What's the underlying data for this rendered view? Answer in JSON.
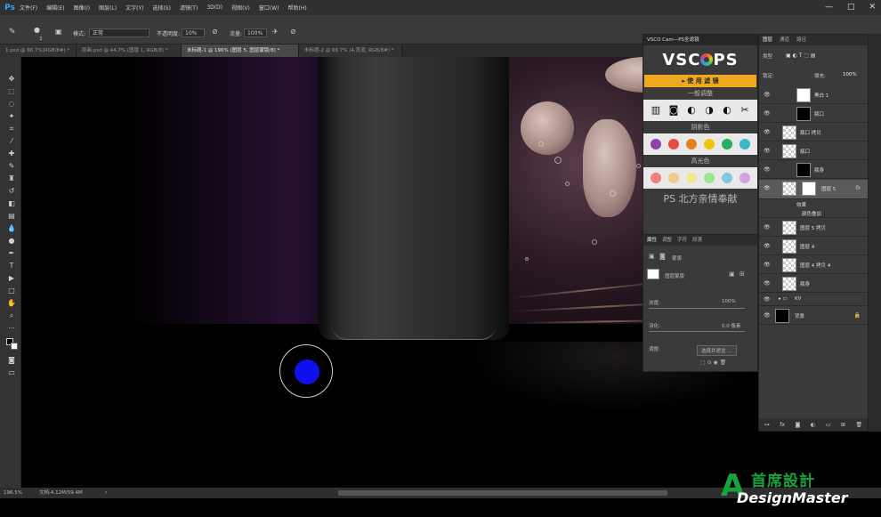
{
  "app": {
    "logo": "Ps"
  },
  "menu": [
    "文件(F)",
    "编辑(E)",
    "图像(I)",
    "图层(L)",
    "文字(Y)",
    "选择(S)",
    "滤镜(T)",
    "3D(D)",
    "视图(V)",
    "窗口(W)",
    "帮助(H)"
  ],
  "window_controls": [
    "—",
    "□",
    "✕"
  ],
  "options": {
    "brush_size": "3",
    "mode_label": "模式:",
    "mode_value": "正常",
    "opacity_label": "不透明度:",
    "opacity_value": "10%",
    "flow_label": "流量:",
    "flow_value": "100%"
  },
  "tabs": [
    {
      "label": "1.psd @ 66.7%(RGB/8#) *",
      "active": false
    },
    {
      "label": "原画.psd @ 44.7% (图层 1, RGB/8) *",
      "active": false
    },
    {
      "label": "未标题-1 @ 196% (图层 5, 图层蒙版/8) *",
      "active": true
    },
    {
      "label": "未标题-2 @ 66.7% (4,背道, RGB/8#) *",
      "active": false
    }
  ],
  "vsco": {
    "title": "VSCO Cam—PS全滤镜",
    "logo_left": "VSC",
    "logo_right": "PS",
    "use_button": "▸  使 用 滤 镜",
    "section_general": "一般调整",
    "section_shadow": "阴影色",
    "section_highlight": "高光色",
    "watermark": "PS 北方亲情奉献",
    "shadow_colors": [
      "#8e44ad",
      "#e74c3c",
      "#e67e22",
      "#f1c40f",
      "#27ae60",
      "#3cb8c4"
    ],
    "highlight_colors": [
      "#f08080",
      "#f0c890",
      "#f0e68c",
      "#9be38c",
      "#7ec8e3",
      "#d6a0e8"
    ]
  },
  "properties": {
    "tabs": [
      "属性",
      "调整",
      "字符",
      "段落"
    ],
    "mask_label": "蒙版",
    "layer_mask_label": "图层蒙版",
    "density_label": "浓度:",
    "density_value": "100%",
    "feather_label": "羽化:",
    "feather_value": "0.0 像素",
    "refine_label": "调整:",
    "refine_button": "选择并遮住 ..."
  },
  "layers": {
    "tabs": [
      "图层",
      "通道",
      "路径"
    ],
    "kind": "类型",
    "fill_label": "填充:",
    "fill_value": "100%",
    "lock_label": "锁定:",
    "rows": [
      {
        "name": "黑白 1",
        "thumb": "white",
        "indent": 0
      },
      {
        "name": "瓶口",
        "thumb": "black",
        "indent": 0
      },
      {
        "name": "瓶口 拷贝",
        "thumb": "checker",
        "indent": 1
      },
      {
        "name": "瓶口",
        "thumb": "checker",
        "indent": 1
      },
      {
        "name": "瓶身",
        "thumb": "black",
        "indent": 0
      },
      {
        "name": "图层 5",
        "thumb": "white",
        "indent": 1,
        "selected": true,
        "fx": "fx"
      },
      {
        "name": "效果",
        "thumb": "none",
        "indent": 2
      },
      {
        "name": "颜色叠加",
        "thumb": "none",
        "indent": 2
      },
      {
        "name": "图层 5 拷贝",
        "thumb": "checker",
        "indent": 1
      },
      {
        "name": "图层 4",
        "thumb": "checker",
        "indent": 1
      },
      {
        "name": "图层 4 拷贝 4",
        "thumb": "checker",
        "indent": 1
      },
      {
        "name": "瓶身",
        "thumb": "checker",
        "indent": 1
      },
      {
        "name": "KV",
        "thumb": "none",
        "indent": 0
      },
      {
        "name": "背景",
        "thumb": "black",
        "indent": 0
      }
    ]
  },
  "status": {
    "zoom": "196.5%",
    "doc": "文档:4.12M/59.4M"
  },
  "watermark_logo": {
    "cn": "首席設計",
    "en": "DesignMaster",
    "a": "A"
  }
}
